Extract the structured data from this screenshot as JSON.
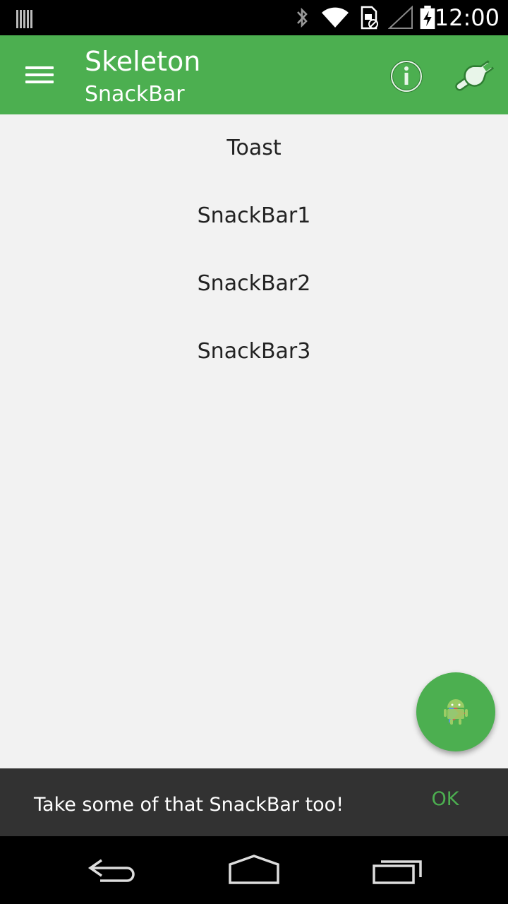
{
  "status_bar": {
    "time": "12:00",
    "icons": [
      "barcode-notification-icon",
      "bluetooth-icon",
      "wifi-icon",
      "sim-card-icon",
      "cell-signal-icon",
      "battery-charging-icon"
    ]
  },
  "app_bar": {
    "title": "Skeleton",
    "subtitle": "SnackBar",
    "color": "#4caf50"
  },
  "list": {
    "items": [
      {
        "label": "Toast"
      },
      {
        "label": "SnackBar1"
      },
      {
        "label": "SnackBar2"
      },
      {
        "label": "SnackBar3"
      }
    ]
  },
  "fab": {
    "icon": "android-play-icon"
  },
  "snackbar": {
    "message": "Take some of that SnackBar too!",
    "action": "OK",
    "action_color": "#4caf50"
  },
  "nav_bar": {
    "icons": [
      "back-icon",
      "home-icon",
      "recents-icon"
    ]
  }
}
